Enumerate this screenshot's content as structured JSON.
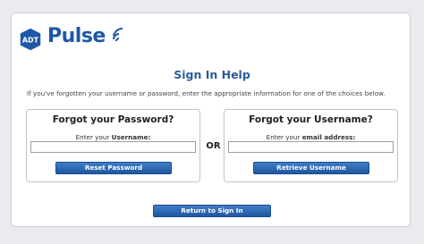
{
  "logo": {
    "badge_text": "ADT",
    "wordmark": "Pulse",
    "brand_color": "#1e57a8"
  },
  "page": {
    "title": "Sign In Help",
    "intro": "If you've forgotten your username or password, enter the appropriate information for one of the choices below."
  },
  "password_box": {
    "title": "Forgot your Password?",
    "label_prefix": "Enter your ",
    "label_bold": "Username:",
    "input_value": "",
    "button": "Reset Password"
  },
  "separator": "OR",
  "username_box": {
    "title": "Forgot your Username?",
    "label_prefix": "Enter your ",
    "label_bold": "email address:",
    "input_value": "",
    "button": "Retrieve Username"
  },
  "return_button": "Return to Sign In",
  "colors": {
    "button_blue": "#2a66b0",
    "title_blue": "#2b5c9b",
    "background": "#e9ebee"
  }
}
